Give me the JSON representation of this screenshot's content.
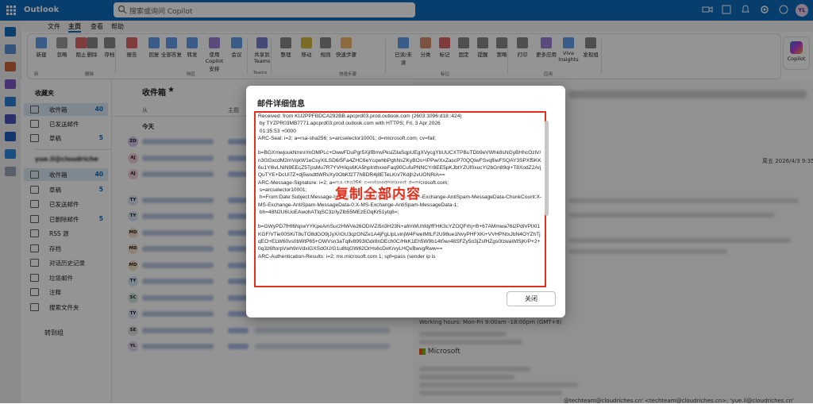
{
  "app": {
    "name": "Outlook",
    "user_initials": "YL"
  },
  "search": {
    "placeholder": "搜索或询问 Copilot"
  },
  "menu": {
    "items": [
      "文件",
      "主页",
      "查看",
      "帮助"
    ]
  },
  "ribbon": {
    "buttons": [
      "新建",
      "忽略",
      "阻止",
      "删除",
      "存档",
      "报告",
      "回复",
      "全部答复",
      "转发",
      "使用 Copilot 安排",
      "会议",
      "共享到 Teams",
      "整理",
      "移动",
      "规则",
      "快速步骤",
      "已读/未读",
      "分类",
      "标记",
      "固定",
      "提醒",
      "策略",
      "打印",
      "更多应用",
      "Viva Insights",
      "发现组"
    ],
    "groups": [
      "新",
      "删除",
      "响应",
      "Teams",
      "快速步骤",
      "标记",
      "应用"
    ],
    "copilot_label": "Copilot"
  },
  "folders": {
    "favorites_title": "收藏夹",
    "favorites": [
      {
        "label": "收件箱",
        "count": "40"
      },
      {
        "label": "已发送邮件",
        "count": ""
      },
      {
        "label": "草稿",
        "count": "5"
      }
    ],
    "account_title": "yue.li@cloudriches.cn",
    "account": [
      {
        "label": "收件箱",
        "count": "40"
      },
      {
        "label": "草稿",
        "count": "5"
      },
      {
        "label": "已发送邮件",
        "count": ""
      },
      {
        "label": "已删除邮件",
        "count": "5"
      },
      {
        "label": "RSS 源",
        "count": ""
      },
      {
        "label": "存档",
        "count": ""
      },
      {
        "label": "对话历史记录",
        "count": ""
      },
      {
        "label": "垃圾邮件",
        "count": ""
      },
      {
        "label": "注释",
        "count": ""
      },
      {
        "label": "搜索文件夹",
        "count": ""
      }
    ],
    "goto_groups": "转到组"
  },
  "maillist": {
    "title": "收件箱",
    "col_from": "从",
    "col_subject": "主题",
    "group_today": "今天",
    "avatars": [
      "ZD",
      "AJ",
      "AJ",
      "TY",
      "TY",
      "MD",
      "MD",
      "MD",
      "TY",
      "SC",
      "TY",
      "SE",
      "YL"
    ],
    "avatar_colors": [
      "#d9c7ee",
      "#f3d0d6",
      "#f3d0d6",
      "#d6e4f5",
      "#d6e4f5",
      "#f5e1c8",
      "#f5e1c8",
      "#f5e1c8",
      "#d6e4f5",
      "#cde9d8",
      "#d6e4f5",
      "#e0e0e0",
      "#e8d3f0"
    ]
  },
  "readpane": {
    "date": "周五 2026/4/3 9:35",
    "working_hours": "Working hours: Mon-Fri 9:00am -18:00pm (GMT+8)",
    "company": "Microsoft",
    "cc_line": "@techteam@cloudriches.cn' <techteam@cloudriches.cn>; 'yue.li@cloudriches.cn'"
  },
  "dialog": {
    "title": "邮件详细信息",
    "headers": "Received: from KU2PPFBDCA292BB.apcprd03.prod.outlook.com (2603:1096:d18::424)\n by TYZPR03MB7771.apcprd03.prod.outlook.com with HTTPS; Fri, 3 Apr 2026\n 01:35:53 +0000\nARC-Seal: i=2; a=rsa-sha256; s=arcselector10001; d=microsoft.com; cv=fail;\n\nb=BGXmwjoukNmnr/mOMPLc+OwwFDuPgr5XjifBrrwPksiZilaSqpUEgXVycgYbUUCXTPBuTDb9eVWhk8sNGyBHhcOzlV/n3GGxcdM2mVqkW1eCsyXILSD6/5Fa4ZHC6eYcqwhbPghNsZKyBOs+IPPw/XxZascP70QQIwFSvqfliwFSQAY3SPXf5KK6u1Yl6vLNiN9EEcZ5TpsMu7R7YVH/iqs6KA5hpInthxxeFaq90CufuPNNCYr8EE5pKJbtYZUf0xucYI2bGn89qi+T8XodZ2ArjQuTYE+DcUl7Z+dj5wsdttWRvXy0ObKf2T7hBDR4j8ETeLKn/7Kdjh2vUONRiA==\nARC-Message-Signature: i=2; a=rsa-sha256; c=relaxed/relaxed; d=microsoft.com;\n s=arcselector10001;\n h=From:Date:Subject:Message-ID:Content-Type:MIME-Version:X-MS-Exchange-AntiSpam-MessageData-ChunkCount:X-MS-Exchange-AntiSpam-MessageData-0:X-MS-Exchange-AntiSpam-MessageData-1;\n bh=48N2U6UoEAwohATlqSC3z/IyZlb55MEzEOqKr51ytq8=;\n\nb=GWyPD7fHf6NpwYYKpeAmSur2HWVe26ODiVZi5n3H23N+afmWUhfdj/fFHK3cYZOQFrhj+B+67AMmwa76i2PdiVPlXl1KGF/VTie00SKiT8uTO8dGO9jJyX/iGU3qzONZe1A4jFgLlpLvinjW4FweIMtLF2U98ue1NvyPHFXKi+VVHPNtxJbN4OYZhTjqEO+ELW60vs0bWtP65+OWVsn3aTqllv8993lGdr8nDEch0C/HkK1Eh5W9b14t0wr48SFZy5n3jZsfHZgs0IzwaWlSjKrP+2+0q3z6ftorpVwh9nVdxiGXSdGU/G1u8tqGW62OrHs6cDxKrvyLHQxBwvgRww==\nARC-Authentication-Results: i=2; mx.microsoft.com 1; spf=pass (sender ip is",
    "annotation": "复制全部内容",
    "close_label": "关闭"
  }
}
